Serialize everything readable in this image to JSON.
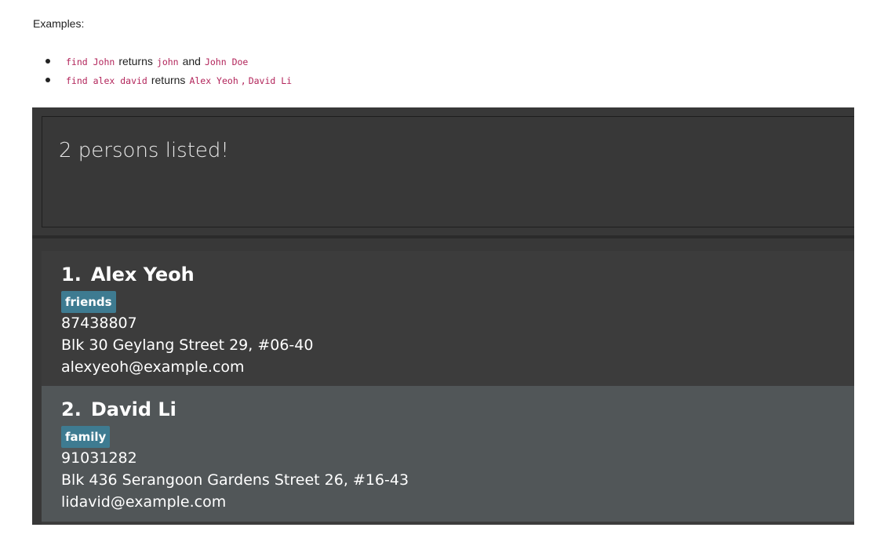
{
  "doc": {
    "examples_label": "Examples:",
    "examples": [
      {
        "command": "find John",
        "verb": "returns",
        "results": [
          "john",
          "John Doe"
        ],
        "joiner": "and"
      },
      {
        "command": "find alex david",
        "verb": "returns",
        "results": [
          "Alex Yeoh",
          "David Li"
        ],
        "joiner": ","
      }
    ]
  },
  "app": {
    "result_message": "2 persons listed!",
    "persons": [
      {
        "index": "1.",
        "name": "Alex Yeoh",
        "tag": "friends",
        "phone": "87438807",
        "address": "Blk 30 Geylang Street 29, #06-40",
        "email": "alexyeoh@example.com"
      },
      {
        "index": "2.",
        "name": "David Li",
        "tag": "family",
        "phone": "91031282",
        "address": "Blk 436 Serangoon Gardens Street 26, #16-43",
        "email": "lidavid@example.com"
      }
    ],
    "colors": {
      "panel_bg": "#383838",
      "card_odd": "#3c3c3c",
      "card_even": "#515658",
      "tag_bg": "#3e7b91",
      "code_text": "#b2245a"
    }
  }
}
